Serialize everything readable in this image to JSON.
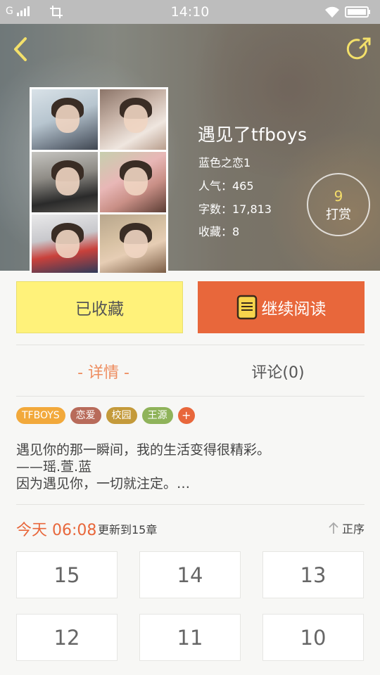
{
  "status_bar": {
    "network": "G",
    "time": "14:10"
  },
  "header": {
    "back_icon": "chevron-left-icon",
    "share_icon": "share-arrow-icon"
  },
  "book": {
    "title": "遇见了tfboys",
    "author": "蓝色之恋1",
    "popularity": "人气：465",
    "word_count": "字数：17,813",
    "favorites": "收藏：8",
    "reward_count": "9",
    "reward_label": "打赏"
  },
  "actions": {
    "favorite_label": "已收藏",
    "read_label": "继续阅读",
    "read_icon": "book-icon"
  },
  "tabs": {
    "detail": "- 详情 -",
    "comments": "评论(0)"
  },
  "tags": [
    {
      "label": "TFBOYS",
      "color": "#f2a93b"
    },
    {
      "label": "恋爱",
      "color": "#b86b5a"
    },
    {
      "label": "校园",
      "color": "#c49a3a"
    },
    {
      "label": "王源",
      "color": "#8fb35a"
    },
    {
      "label": "+",
      "color": "#e8673b"
    }
  ],
  "description": [
    "遇见你的那一瞬间，我的生活变得很精彩。",
    "——瑶.萱.蓝",
    "因为遇见你，一切就注定。…"
  ],
  "update": {
    "time": "今天 06:08",
    "text": "更新到15章",
    "sort_label": "正序",
    "sort_icon": "arrow-up-icon"
  },
  "chapters": [
    "15",
    "14",
    "13",
    "12",
    "11",
    "10"
  ],
  "colors": {
    "accent": "#e8673b",
    "favorite_bg": "#fff27a",
    "tab_active": "#ee8c5e"
  }
}
